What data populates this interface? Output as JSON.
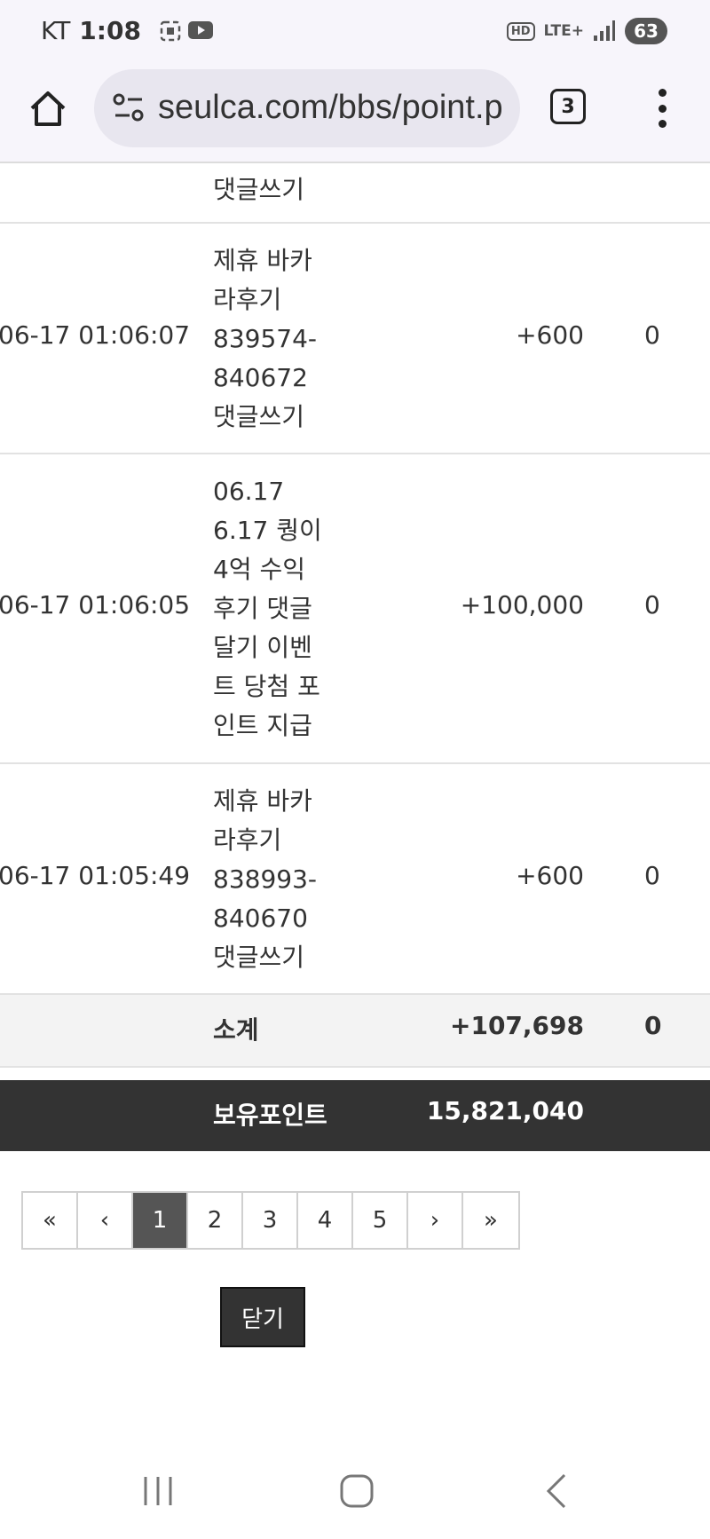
{
  "status_bar": {
    "carrier": "KT",
    "time": "1:08",
    "hd_label": "HD",
    "network": "LTE+",
    "battery": "63"
  },
  "browser": {
    "url": "seulca.com/bbs/point.p",
    "tab_count": "3"
  },
  "rows": [
    {
      "date": "",
      "content_lines": [
        "댓글쓰기"
      ],
      "point": "",
      "use": ""
    },
    {
      "date": "06-17 01:06:07",
      "content_lines": [
        "제휴 바카",
        "라후기",
        "839574-",
        "840672",
        "댓글쓰기"
      ],
      "point": "+600",
      "use": "0"
    },
    {
      "date": "06-17 01:06:05",
      "content_lines": [
        "06.17",
        "6.17 퀑이",
        "4억 수익",
        "후기 댓글",
        "달기 이벤",
        "트 당첨 포",
        "인트 지급"
      ],
      "point": "+100,000",
      "use": "0"
    },
    {
      "date": "06-17 01:05:49",
      "content_lines": [
        "제휴 바카",
        "라후기",
        "838993-",
        "840670",
        "댓글쓰기"
      ],
      "point": "+600",
      "use": "0"
    }
  ],
  "subtotal": {
    "label": "소계",
    "point": "+107,698",
    "use": "0"
  },
  "total": {
    "label": "보유포인트",
    "point": "15,821,040"
  },
  "pagination": {
    "first": "«",
    "prev": "‹",
    "pages": [
      "1",
      "2",
      "3",
      "4",
      "5"
    ],
    "active_page": "1",
    "next": "›",
    "last": "»"
  },
  "close_label": "닫기"
}
